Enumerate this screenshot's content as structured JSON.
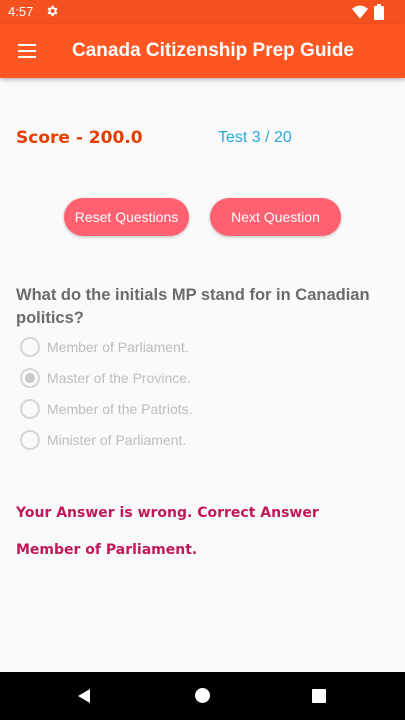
{
  "status_bar": {
    "time": "4:57",
    "icons": [
      "settings-icon",
      "wifi-icon",
      "battery-icon"
    ]
  },
  "app_bar": {
    "title": "Canada Citizenship Prep Guide",
    "menu_icon": "hamburger-menu-icon",
    "background_color": "#FF5722"
  },
  "score_label": "Score - 200.0",
  "test_counter": "Test 3 / 20",
  "buttons": {
    "reset": "Reset Questions",
    "next": "Next Question",
    "color": "#FF6170"
  },
  "question": {
    "text": "What do the initials MP stand for in Canadian politics?",
    "options": [
      {
        "label": "Member of Parliament.",
        "selected": false
      },
      {
        "label": "Master of the Province.",
        "selected": true
      },
      {
        "label": "Member of the Patriots.",
        "selected": false
      },
      {
        "label": "Minister of Parliament.",
        "selected": false
      }
    ]
  },
  "feedback": {
    "line1": "Your Answer is wrong. Correct Answer",
    "line2": "Member of Parliament."
  },
  "nav_bar": {
    "icons": [
      "back-icon",
      "home-icon",
      "recents-icon"
    ]
  }
}
